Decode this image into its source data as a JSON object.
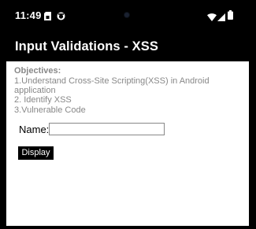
{
  "status_bar": {
    "time": "11:49",
    "left_icons": [
      "sim-card-icon",
      "sync-icon"
    ],
    "right_icons": [
      "wifi-icon",
      "signal-icon",
      "battery-icon"
    ]
  },
  "app_bar": {
    "title": "Input Validations - XSS"
  },
  "objectives": {
    "heading": "Objectives:",
    "lines": [
      " 1.Understand Cross-Site Scripting(XSS) in Android",
      "application",
      " 2. Identify XSS",
      " 3.Vulnerable Code"
    ]
  },
  "form": {
    "name_label": "Name:",
    "name_value": "",
    "display_button": "Display"
  },
  "colors": {
    "background": "#000000",
    "content_background": "#ffffff",
    "objective_text": "#888888"
  }
}
